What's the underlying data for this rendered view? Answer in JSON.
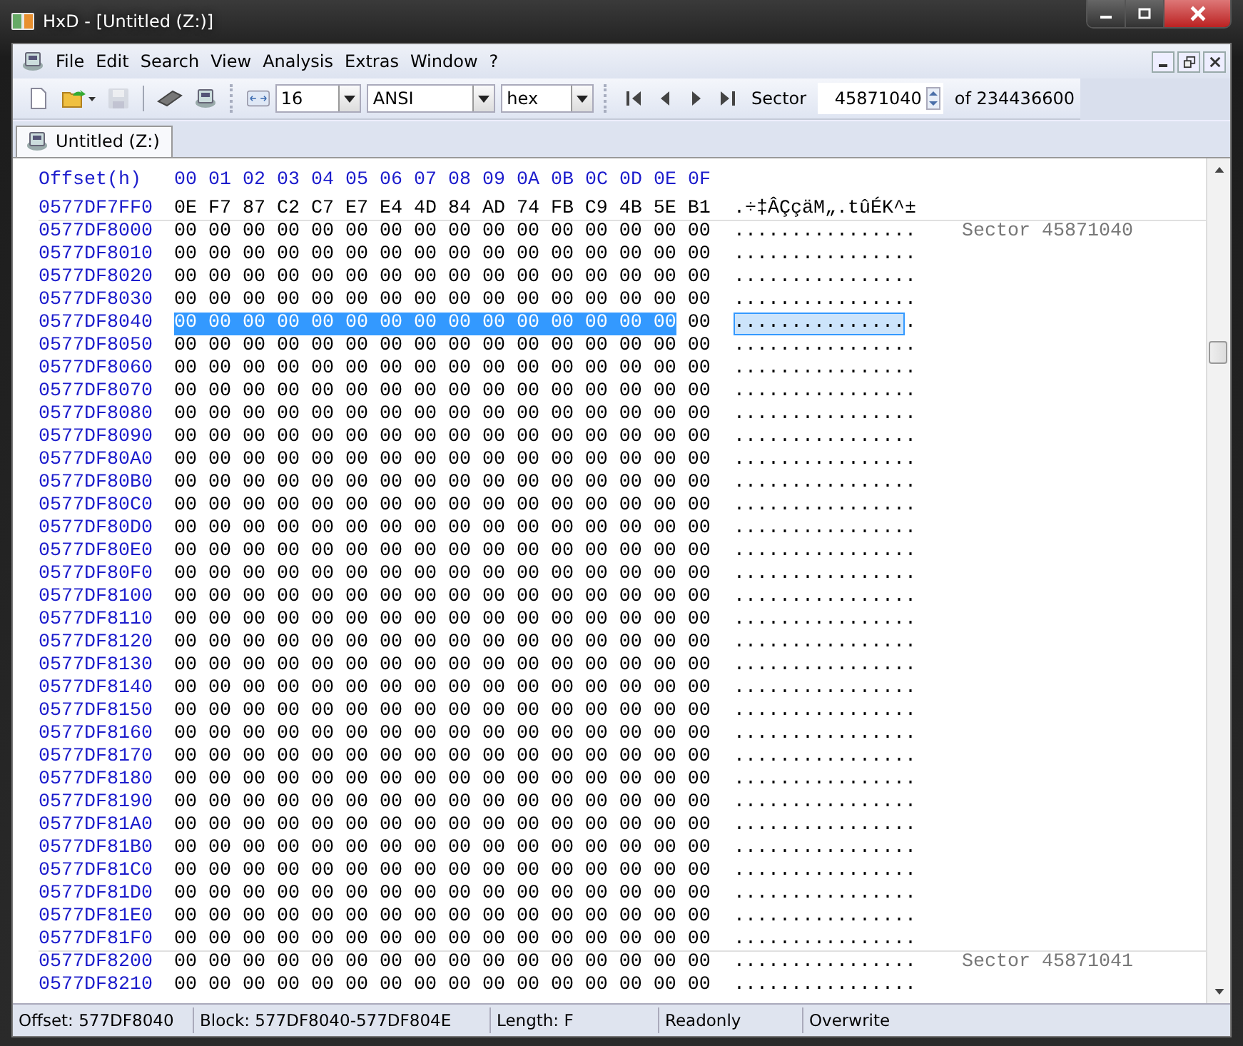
{
  "window": {
    "title": "HxD - [Untitled (Z:)]"
  },
  "menu": [
    "File",
    "Edit",
    "Search",
    "View",
    "Analysis",
    "Extras",
    "Window",
    "?"
  ],
  "toolbar": {
    "buttons": [
      {
        "kind": "new",
        "disabled": false
      },
      {
        "kind": "open",
        "disabled": false
      },
      {
        "kind": "save",
        "disabled": true
      },
      {
        "kind": "ram",
        "disabled": false
      },
      {
        "kind": "disk",
        "disabled": false
      }
    ],
    "bytes_per_row": "16",
    "charset": "ANSI",
    "offset_base": "hex",
    "nav": [
      {
        "kind": "first"
      },
      {
        "kind": "prev"
      },
      {
        "kind": "next"
      },
      {
        "kind": "last"
      }
    ],
    "sector_label": "Sector",
    "sector": "45871040",
    "sector_total": "of 234436600"
  },
  "tabs": [
    {
      "label": "Untitled (Z:)",
      "selected": true
    }
  ],
  "editor": {
    "offset_header": "Offset(h)",
    "columns": [
      "00",
      "01",
      "02",
      "03",
      "04",
      "05",
      "06",
      "07",
      "08",
      "09",
      "0A",
      "0B",
      "0C",
      "0D",
      "0E",
      "0F"
    ],
    "rows": [
      {
        "offset": "0577DF7FF0",
        "hex": [
          {
            "text": "0E F7 87 C2 C7 E7 E4 4D 84 AD 74 FB C9 4B 5E B1",
            "selected": false
          }
        ],
        "ascii": [
          {
            "text": ".÷‡ÂÇçäM„.tûÉK^±",
            "selected": false
          }
        ]
      },
      {
        "offset": "0577DF8000",
        "hex": [
          {
            "text": "00 00 00 00 00 00 00 00 00 00 00 00 00 00 00 00",
            "selected": false
          }
        ],
        "ascii": [
          {
            "text": "................",
            "selected": false
          }
        ],
        "sector_label": "Sector 45871040"
      },
      {
        "offset": "0577DF8010",
        "hex": [
          {
            "text": "00 00 00 00 00 00 00 00 00 00 00 00 00 00 00 00",
            "selected": false
          }
        ],
        "ascii": [
          {
            "text": "................",
            "selected": false
          }
        ]
      },
      {
        "offset": "0577DF8020",
        "hex": [
          {
            "text": "00 00 00 00 00 00 00 00 00 00 00 00 00 00 00 00",
            "selected": false
          }
        ],
        "ascii": [
          {
            "text": "................",
            "selected": false
          }
        ]
      },
      {
        "offset": "0577DF8030",
        "hex": [
          {
            "text": "00 00 00 00 00 00 00 00 00 00 00 00 00 00 00 00",
            "selected": false
          }
        ],
        "ascii": [
          {
            "text": "................",
            "selected": false
          }
        ]
      },
      {
        "offset": "0577DF8040",
        "hex": [
          {
            "text": "00 00 00 00 00 00 00 00 00 00 00 00 00 00 00",
            "selected": true
          },
          {
            "text": "00",
            "selected": false
          }
        ],
        "ascii": [
          {
            "text": "...............",
            "selected": true
          },
          {
            "text": ".",
            "selected": false
          }
        ]
      },
      {
        "offset": "0577DF8050",
        "hex": [
          {
            "text": "00 00 00 00 00 00 00 00 00 00 00 00 00 00 00 00",
            "selected": false
          }
        ],
        "ascii": [
          {
            "text": "................",
            "selected": false
          }
        ]
      },
      {
        "offset": "0577DF8060",
        "hex": [
          {
            "text": "00 00 00 00 00 00 00 00 00 00 00 00 00 00 00 00",
            "selected": false
          }
        ],
        "ascii": [
          {
            "text": "................",
            "selected": false
          }
        ]
      },
      {
        "offset": "0577DF8070",
        "hex": [
          {
            "text": "00 00 00 00 00 00 00 00 00 00 00 00 00 00 00 00",
            "selected": false
          }
        ],
        "ascii": [
          {
            "text": "................",
            "selected": false
          }
        ]
      },
      {
        "offset": "0577DF8080",
        "hex": [
          {
            "text": "00 00 00 00 00 00 00 00 00 00 00 00 00 00 00 00",
            "selected": false
          }
        ],
        "ascii": [
          {
            "text": "................",
            "selected": false
          }
        ]
      },
      {
        "offset": "0577DF8090",
        "hex": [
          {
            "text": "00 00 00 00 00 00 00 00 00 00 00 00 00 00 00 00",
            "selected": false
          }
        ],
        "ascii": [
          {
            "text": "................",
            "selected": false
          }
        ]
      },
      {
        "offset": "0577DF80A0",
        "hex": [
          {
            "text": "00 00 00 00 00 00 00 00 00 00 00 00 00 00 00 00",
            "selected": false
          }
        ],
        "ascii": [
          {
            "text": "................",
            "selected": false
          }
        ]
      },
      {
        "offset": "0577DF80B0",
        "hex": [
          {
            "text": "00 00 00 00 00 00 00 00 00 00 00 00 00 00 00 00",
            "selected": false
          }
        ],
        "ascii": [
          {
            "text": "................",
            "selected": false
          }
        ]
      },
      {
        "offset": "0577DF80C0",
        "hex": [
          {
            "text": "00 00 00 00 00 00 00 00 00 00 00 00 00 00 00 00",
            "selected": false
          }
        ],
        "ascii": [
          {
            "text": "................",
            "selected": false
          }
        ]
      },
      {
        "offset": "0577DF80D0",
        "hex": [
          {
            "text": "00 00 00 00 00 00 00 00 00 00 00 00 00 00 00 00",
            "selected": false
          }
        ],
        "ascii": [
          {
            "text": "................",
            "selected": false
          }
        ]
      },
      {
        "offset": "0577DF80E0",
        "hex": [
          {
            "text": "00 00 00 00 00 00 00 00 00 00 00 00 00 00 00 00",
            "selected": false
          }
        ],
        "ascii": [
          {
            "text": "................",
            "selected": false
          }
        ]
      },
      {
        "offset": "0577DF80F0",
        "hex": [
          {
            "text": "00 00 00 00 00 00 00 00 00 00 00 00 00 00 00 00",
            "selected": false
          }
        ],
        "ascii": [
          {
            "text": "................",
            "selected": false
          }
        ]
      },
      {
        "offset": "0577DF8100",
        "hex": [
          {
            "text": "00 00 00 00 00 00 00 00 00 00 00 00 00 00 00 00",
            "selected": false
          }
        ],
        "ascii": [
          {
            "text": "................",
            "selected": false
          }
        ]
      },
      {
        "offset": "0577DF8110",
        "hex": [
          {
            "text": "00 00 00 00 00 00 00 00 00 00 00 00 00 00 00 00",
            "selected": false
          }
        ],
        "ascii": [
          {
            "text": "................",
            "selected": false
          }
        ]
      },
      {
        "offset": "0577DF8120",
        "hex": [
          {
            "text": "00 00 00 00 00 00 00 00 00 00 00 00 00 00 00 00",
            "selected": false
          }
        ],
        "ascii": [
          {
            "text": "................",
            "selected": false
          }
        ]
      },
      {
        "offset": "0577DF8130",
        "hex": [
          {
            "text": "00 00 00 00 00 00 00 00 00 00 00 00 00 00 00 00",
            "selected": false
          }
        ],
        "ascii": [
          {
            "text": "................",
            "selected": false
          }
        ]
      },
      {
        "offset": "0577DF8140",
        "hex": [
          {
            "text": "00 00 00 00 00 00 00 00 00 00 00 00 00 00 00 00",
            "selected": false
          }
        ],
        "ascii": [
          {
            "text": "................",
            "selected": false
          }
        ]
      },
      {
        "offset": "0577DF8150",
        "hex": [
          {
            "text": "00 00 00 00 00 00 00 00 00 00 00 00 00 00 00 00",
            "selected": false
          }
        ],
        "ascii": [
          {
            "text": "................",
            "selected": false
          }
        ]
      },
      {
        "offset": "0577DF8160",
        "hex": [
          {
            "text": "00 00 00 00 00 00 00 00 00 00 00 00 00 00 00 00",
            "selected": false
          }
        ],
        "ascii": [
          {
            "text": "................",
            "selected": false
          }
        ]
      },
      {
        "offset": "0577DF8170",
        "hex": [
          {
            "text": "00 00 00 00 00 00 00 00 00 00 00 00 00 00 00 00",
            "selected": false
          }
        ],
        "ascii": [
          {
            "text": "................",
            "selected": false
          }
        ]
      },
      {
        "offset": "0577DF8180",
        "hex": [
          {
            "text": "00 00 00 00 00 00 00 00 00 00 00 00 00 00 00 00",
            "selected": false
          }
        ],
        "ascii": [
          {
            "text": "................",
            "selected": false
          }
        ]
      },
      {
        "offset": "0577DF8190",
        "hex": [
          {
            "text": "00 00 00 00 00 00 00 00 00 00 00 00 00 00 00 00",
            "selected": false
          }
        ],
        "ascii": [
          {
            "text": "................",
            "selected": false
          }
        ]
      },
      {
        "offset": "0577DF81A0",
        "hex": [
          {
            "text": "00 00 00 00 00 00 00 00 00 00 00 00 00 00 00 00",
            "selected": false
          }
        ],
        "ascii": [
          {
            "text": "................",
            "selected": false
          }
        ]
      },
      {
        "offset": "0577DF81B0",
        "hex": [
          {
            "text": "00 00 00 00 00 00 00 00 00 00 00 00 00 00 00 00",
            "selected": false
          }
        ],
        "ascii": [
          {
            "text": "................",
            "selected": false
          }
        ]
      },
      {
        "offset": "0577DF81C0",
        "hex": [
          {
            "text": "00 00 00 00 00 00 00 00 00 00 00 00 00 00 00 00",
            "selected": false
          }
        ],
        "ascii": [
          {
            "text": "................",
            "selected": false
          }
        ]
      },
      {
        "offset": "0577DF81D0",
        "hex": [
          {
            "text": "00 00 00 00 00 00 00 00 00 00 00 00 00 00 00 00",
            "selected": false
          }
        ],
        "ascii": [
          {
            "text": "................",
            "selected": false
          }
        ]
      },
      {
        "offset": "0577DF81E0",
        "hex": [
          {
            "text": "00 00 00 00 00 00 00 00 00 00 00 00 00 00 00 00",
            "selected": false
          }
        ],
        "ascii": [
          {
            "text": "................",
            "selected": false
          }
        ]
      },
      {
        "offset": "0577DF81F0",
        "hex": [
          {
            "text": "00 00 00 00 00 00 00 00 00 00 00 00 00 00 00 00",
            "selected": false
          }
        ],
        "ascii": [
          {
            "text": "................",
            "selected": false
          }
        ]
      },
      {
        "offset": "0577DF8200",
        "hex": [
          {
            "text": "00 00 00 00 00 00 00 00 00 00 00 00 00 00 00 00",
            "selected": false
          }
        ],
        "ascii": [
          {
            "text": "................",
            "selected": false
          }
        ],
        "sector_label": "Sector 45871041"
      },
      {
        "offset": "0577DF8210",
        "hex": [
          {
            "text": "00 00 00 00 00 00 00 00 00 00 00 00 00 00 00 00",
            "selected": false
          }
        ],
        "ascii": [
          {
            "text": "................",
            "selected": false
          }
        ]
      }
    ]
  },
  "status_bar": [
    "Offset: 577DF8040",
    "Block: 577DF8040-577DF804E",
    "Length: F",
    "Readonly",
    "Overwrite"
  ]
}
